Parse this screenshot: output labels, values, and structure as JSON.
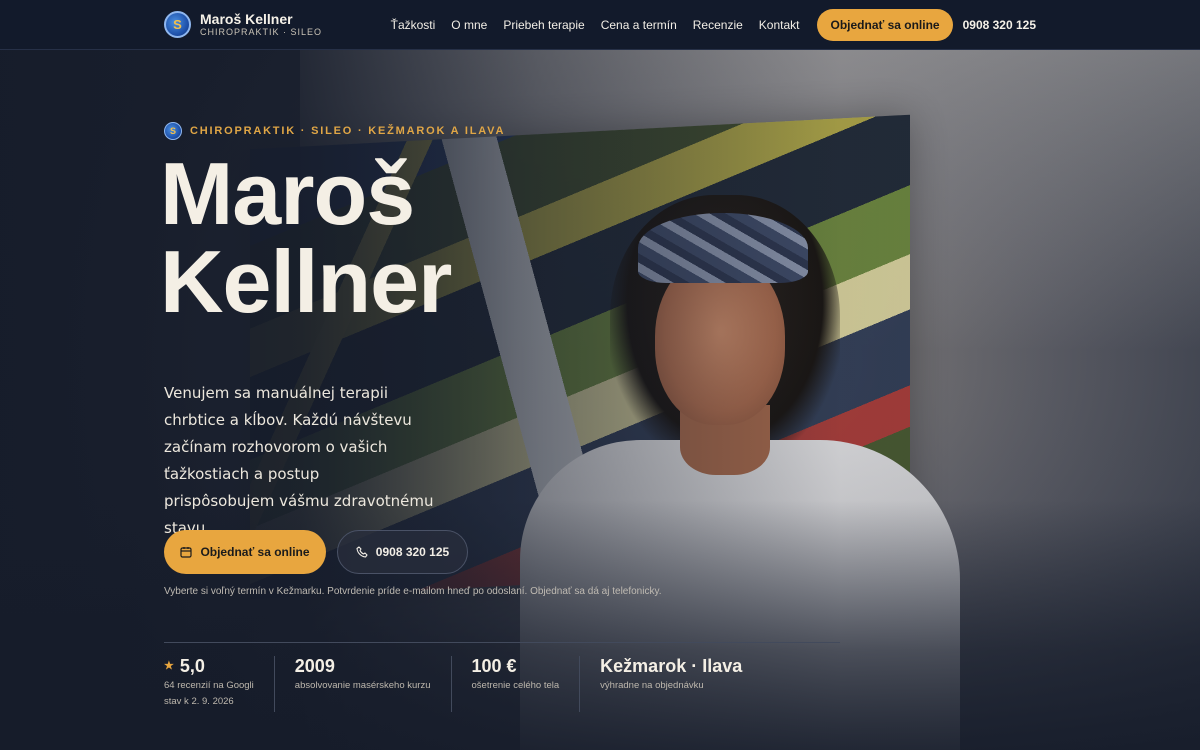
{
  "brand": {
    "name": "Maroš Kellner",
    "subtitle": "CHIROPRAKTIK · SILEO",
    "logo_glyph": "S"
  },
  "nav": {
    "links": [
      "Ťažkosti",
      "O mne",
      "Priebeh terapie",
      "Cena a termín",
      "Recenzie",
      "Kontakt"
    ],
    "cta_label": "Objednať sa online",
    "phone": "0908 320 125"
  },
  "hero": {
    "eyebrow": "CHIROPRAKTIK · SILEO · KEŽMAROK A ILAVA",
    "title_line1": "Maroš",
    "title_line2": "Kellner",
    "description": "Venujem sa manuálnej terapii chrbtice a kĺbov. Každú návštevu začínam rozhovorom o vašich ťažkostiach a postup prispôsobujem vášmu zdravotnému stavu.",
    "primary_button": "Objednať sa online",
    "primary_icon": "calendar-icon",
    "secondary_button": "0908 320 125",
    "secondary_icon": "phone-icon",
    "booking_note": "Vyberte si voľný termín v Kežmarku. Potvrdenie príde e-mailom hneď po odoslaní. Objednať sa dá aj telefonicky."
  },
  "stats": [
    {
      "value": "5,0",
      "label1": "64 recenzií na Googli",
      "label2": "stav k 2. 9. 2026",
      "icon": "star-icon"
    },
    {
      "value": "2009",
      "label1": "absolvovanie masérskeho kurzu",
      "label2": ""
    },
    {
      "value": "100 €",
      "label1": "ošetrenie celého tela",
      "label2": ""
    },
    {
      "value": "Kežmarok · Ilava",
      "label1": "výhradne na objednávku",
      "label2": ""
    }
  ],
  "colors": {
    "accent": "#e8a63f",
    "navbar": "#121a2b",
    "text": "#f4efe5"
  }
}
